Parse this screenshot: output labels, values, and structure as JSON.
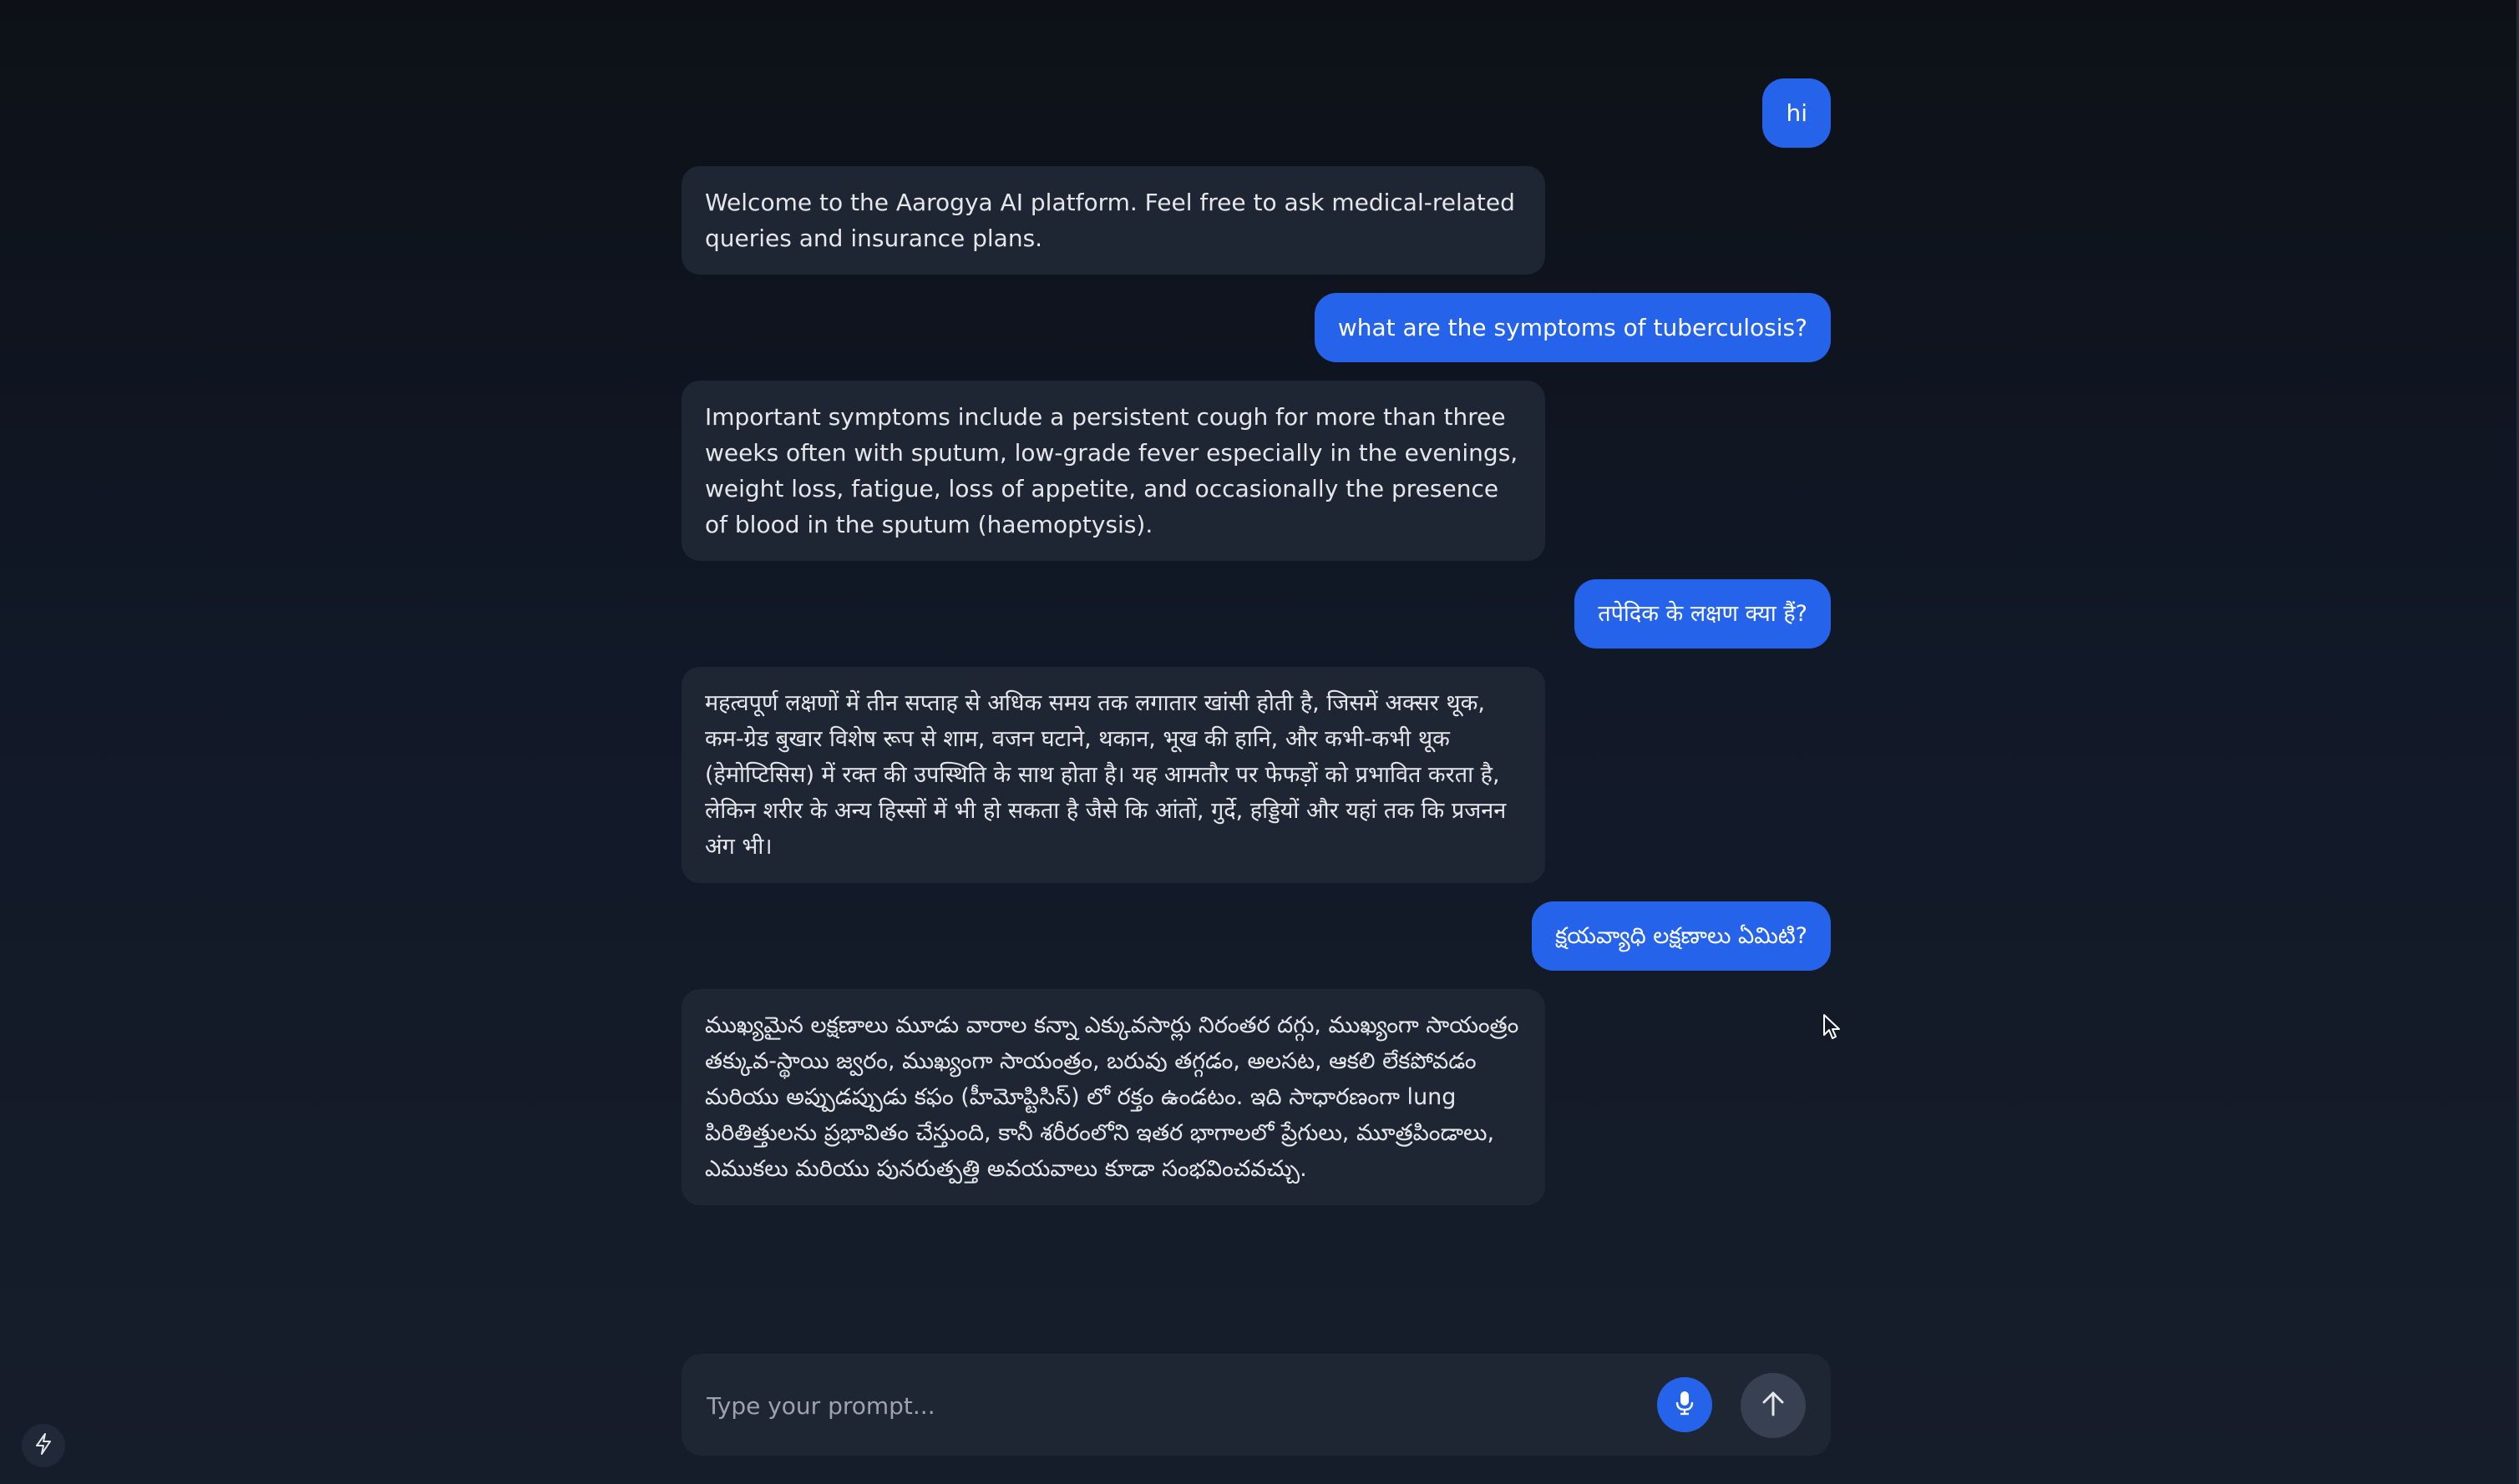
{
  "messages": [
    {
      "role": "user",
      "text": "hi"
    },
    {
      "role": "assistant",
      "text": "Welcome to the Aarogya AI platform. Feel free to ask medical-related queries and insurance plans."
    },
    {
      "role": "user",
      "text": "what are the symptoms of tuberculosis?"
    },
    {
      "role": "assistant",
      "text": "Important symptoms include a persistent cough for more than three weeks often with sputum, low-grade fever especially in the evenings, weight loss, fatigue, loss of appetite, and occasionally the presence of blood in the sputum (haemoptysis)."
    },
    {
      "role": "user",
      "text": "तपेदिक के लक्षण क्या हैं?"
    },
    {
      "role": "assistant",
      "text": "महत्वपूर्ण लक्षणों में तीन सप्ताह से अधिक समय तक लगातार खांसी होती है, जिसमें अक्सर थूक, कम-ग्रेड बुखार विशेष रूप से शाम, वजन घटाने, थकान, भूख की हानि, और कभी-कभी थूक (हेमोप्टिसिस) में रक्त की उपस्थिति के साथ होता है। यह आमतौर पर फेफड़ों को प्रभावित करता है, लेकिन शरीर के अन्य हिस्सों में भी हो सकता है जैसे कि आंतों, गुर्दे, हड्डियों और यहां तक कि प्रजनन अंग भी।"
    },
    {
      "role": "user",
      "text": "క్షయవ్యాధి లక్షణాలు ఏమిటి?"
    },
    {
      "role": "assistant",
      "text": "ముఖ్యమైన లక్షణాలు మూడు వారాల కన్నా ఎక్కువసార్లు నిరంతర దగ్గు, ముఖ్యంగా సాయంత్రం తక్కువ-స్థాయి జ్వరం, ముఖ్యంగా సాయంత్రం, బరువు తగ్గడం, అలసట, ఆకలి లేకపోవడం మరియు అప్పుడప్పుడు కఫం (హీమోప్టిసిస్) లో రక్తం ఉండటం. ఇది సాధారణంగా lung పిరితిత్తులను ప్రభావితం చేస్తుంది, కానీ శరీరంలోని ఇతర భాగాలలో ప్రేగులు, మూత్రపిండాలు, ఎముకలు మరియు పునరుత్పత్తి అవయవాలు కూడా సంభవించవచ్చు."
    }
  ],
  "composer": {
    "placeholder": "Type your prompt..."
  },
  "icons": {
    "mic": "microphone-icon",
    "send": "arrow-up-icon",
    "bolt": "lightning-bolt-icon"
  },
  "colors": {
    "user_bubble": "#2563eb",
    "assistant_bubble": "#1f2633",
    "background": "#111827"
  }
}
